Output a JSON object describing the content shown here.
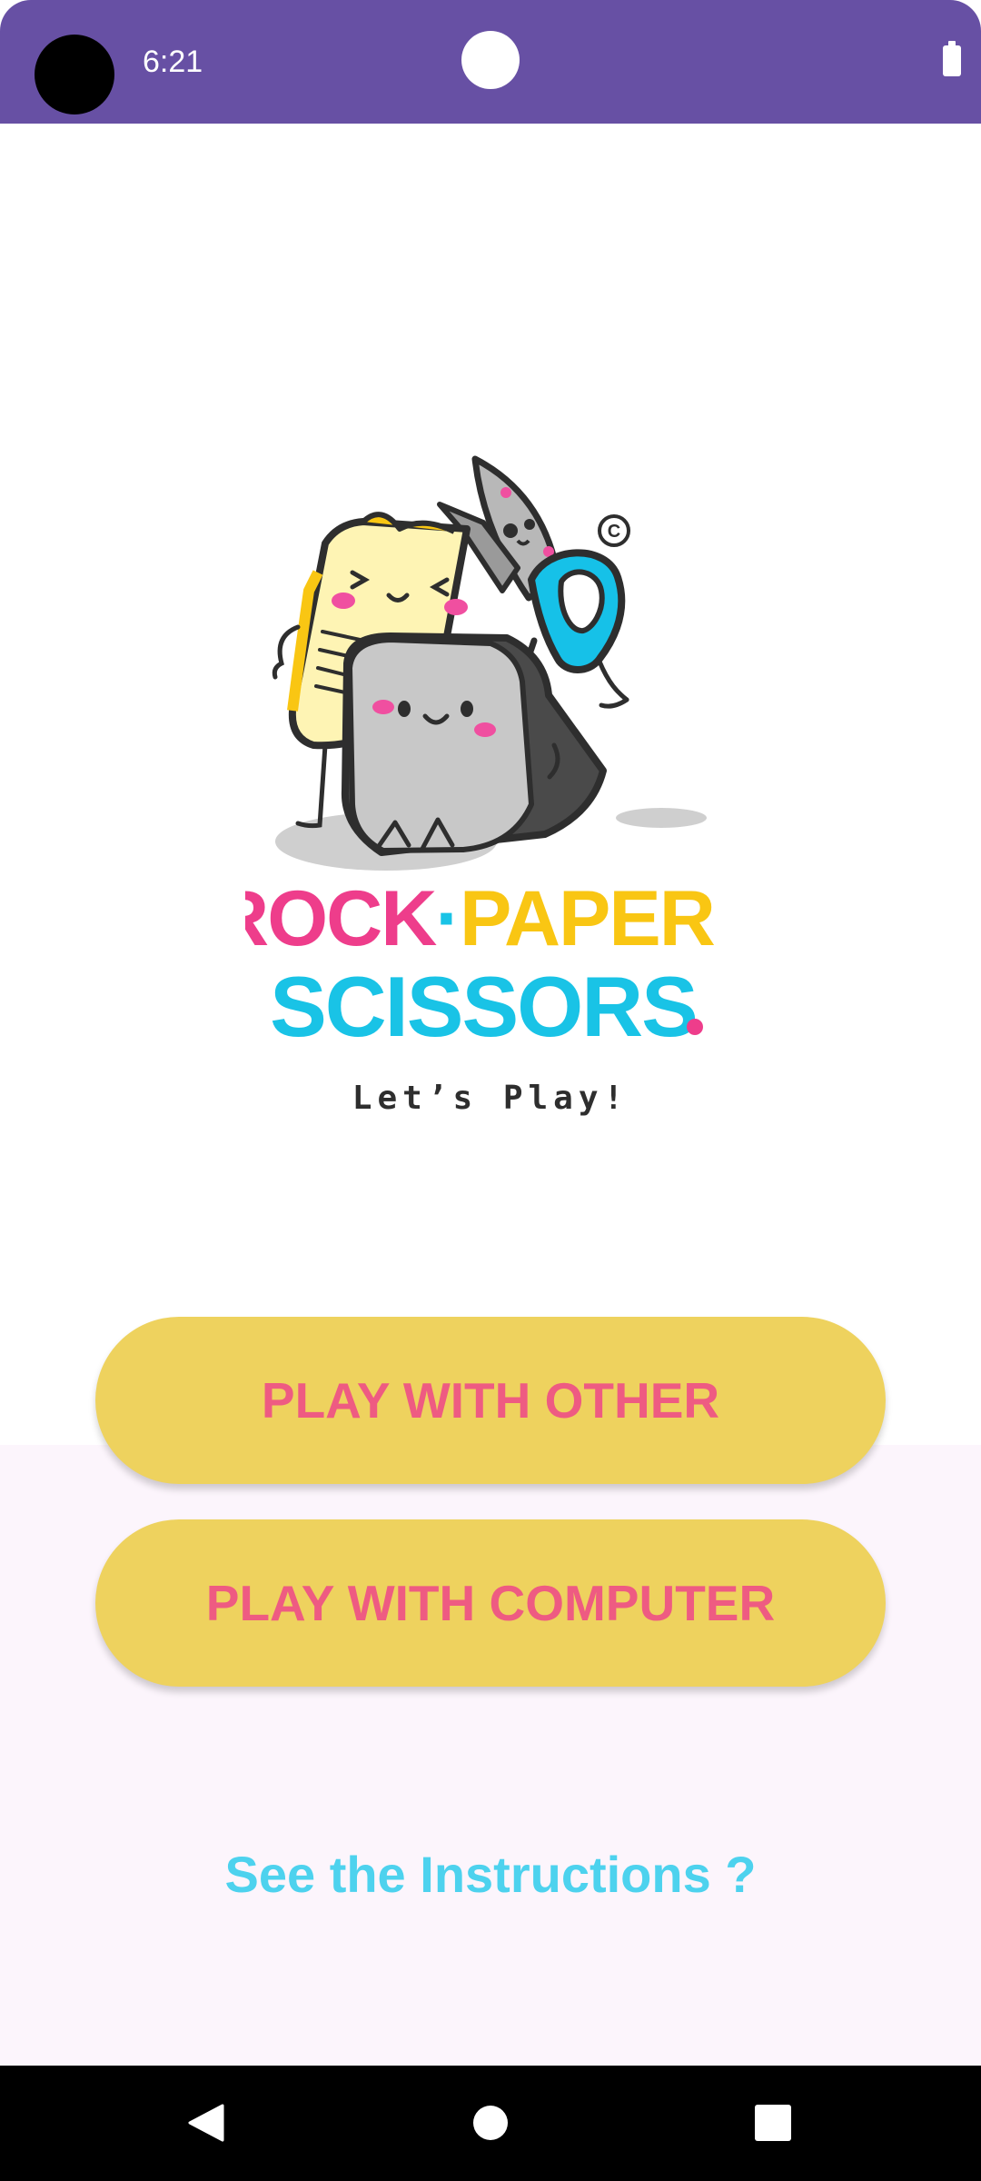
{
  "status_bar": {
    "time": "6:21",
    "bg_color": "#6750A4",
    "icons": [
      "camera-cutout",
      "battery-icon"
    ]
  },
  "logo": {
    "title_rock": "ROCK",
    "separator": "·",
    "title_paper": "PAPER",
    "title_scissors": "SCISSORS",
    "copyright": "©",
    "tagline": "Let’s Play!",
    "colors": {
      "rock": "#EE3D8B",
      "paper": "#F9C613",
      "scissors": "#19C3E6",
      "tagline": "#2E2E2E"
    }
  },
  "buttons": {
    "play_other": "PLAY WITH OTHER",
    "play_computer": "PLAY WITH COMPUTER",
    "bg_color": "#EED25E",
    "text_color": "#EE5B82"
  },
  "links": {
    "instructions": "See the Instructions ?",
    "color": "#4DD2EE"
  },
  "nav_bar": {
    "icons": [
      "back-icon",
      "home-icon",
      "recents-icon"
    ]
  }
}
